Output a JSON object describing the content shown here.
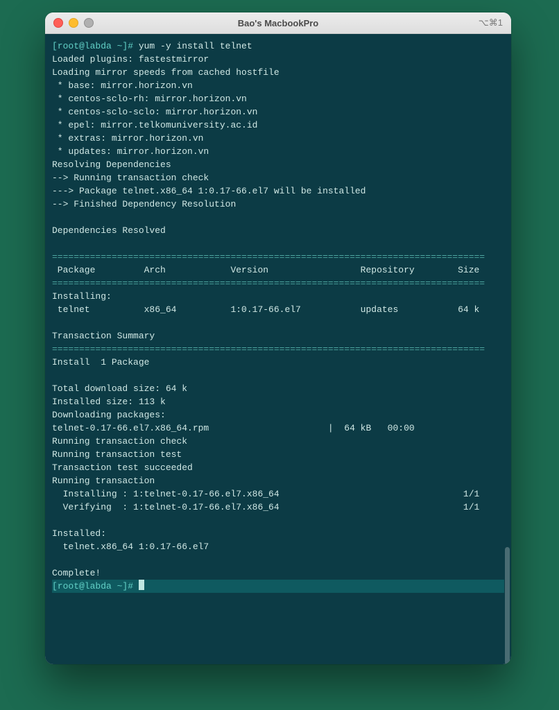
{
  "window": {
    "title": "Bao's MacbookPro",
    "shortcut": "⌥⌘1"
  },
  "terminal": {
    "prompt1_user": "[root@labda ~]#",
    "prompt1_cmd": " yum -y install telnet",
    "lines_top": [
      "Loaded plugins: fastestmirror",
      "Loading mirror speeds from cached hostfile",
      " * base: mirror.horizon.vn",
      " * centos-sclo-rh: mirror.horizon.vn",
      " * centos-sclo-sclo: mirror.horizon.vn",
      " * epel: mirror.telkomuniversity.ac.id",
      " * extras: mirror.horizon.vn",
      " * updates: mirror.horizon.vn",
      "Resolving Dependencies",
      "--> Running transaction check",
      "---> Package telnet.x86_64 1:0.17-66.el7 will be installed",
      "--> Finished Dependency Resolution",
      "",
      "Dependencies Resolved",
      ""
    ],
    "divider": "================================================================================",
    "header_row": " Package         Arch            Version                 Repository        Size",
    "installing_label": "Installing:",
    "pkg_row": " telnet          x86_64          1:0.17-66.el7           updates           64 k",
    "blank": "",
    "txn_summary": "Transaction Summary",
    "install_count": "Install  1 Package",
    "lines_mid": [
      "",
      "Total download size: 64 k",
      "Installed size: 113 k",
      "Downloading packages:",
      "telnet-0.17-66.el7.x86_64.rpm                      |  64 kB   00:00",
      "Running transaction check",
      "Running transaction test",
      "Transaction test succeeded",
      "Running transaction",
      "  Installing : 1:telnet-0.17-66.el7.x86_64                                  1/1",
      "  Verifying  : 1:telnet-0.17-66.el7.x86_64                                  1/1",
      "",
      "Installed:",
      "  telnet.x86_64 1:0.17-66.el7",
      "",
      "Complete!"
    ],
    "prompt2_user": "[root@labda ~]#",
    "prompt2_cmd": " "
  }
}
